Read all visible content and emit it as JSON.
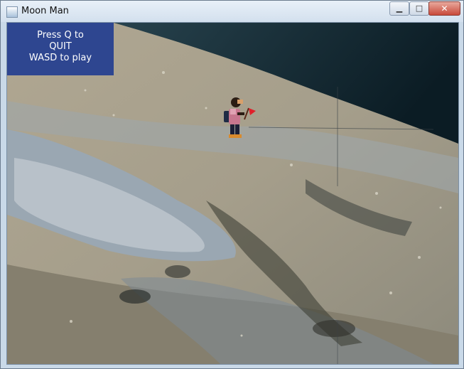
{
  "window": {
    "title": "Moon Man",
    "icon": "app-window-icon"
  },
  "controls": {
    "minimize": "minimize-icon",
    "maximize": "maximize-icon",
    "close": "close-icon"
  },
  "hud": {
    "line1": "Press Q to",
    "line2": "QUIT",
    "line3": "WASD to play"
  },
  "colors": {
    "hud_bg": "#2e4690",
    "sky": "#0f2530",
    "flag": "#e0202a"
  }
}
